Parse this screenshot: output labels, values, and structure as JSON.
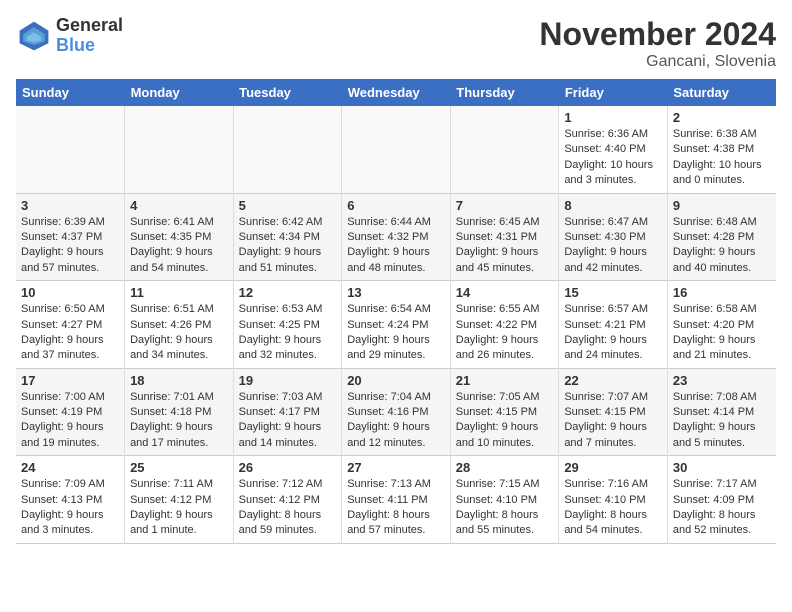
{
  "header": {
    "logo_line1": "General",
    "logo_line2": "Blue",
    "month": "November 2024",
    "location": "Gancani, Slovenia"
  },
  "days_of_week": [
    "Sunday",
    "Monday",
    "Tuesday",
    "Wednesday",
    "Thursday",
    "Friday",
    "Saturday"
  ],
  "weeks": [
    [
      {
        "day": "",
        "info": ""
      },
      {
        "day": "",
        "info": ""
      },
      {
        "day": "",
        "info": ""
      },
      {
        "day": "",
        "info": ""
      },
      {
        "day": "",
        "info": ""
      },
      {
        "day": "1",
        "info": "Sunrise: 6:36 AM\nSunset: 4:40 PM\nDaylight: 10 hours and 3 minutes."
      },
      {
        "day": "2",
        "info": "Sunrise: 6:38 AM\nSunset: 4:38 PM\nDaylight: 10 hours and 0 minutes."
      }
    ],
    [
      {
        "day": "3",
        "info": "Sunrise: 6:39 AM\nSunset: 4:37 PM\nDaylight: 9 hours and 57 minutes."
      },
      {
        "day": "4",
        "info": "Sunrise: 6:41 AM\nSunset: 4:35 PM\nDaylight: 9 hours and 54 minutes."
      },
      {
        "day": "5",
        "info": "Sunrise: 6:42 AM\nSunset: 4:34 PM\nDaylight: 9 hours and 51 minutes."
      },
      {
        "day": "6",
        "info": "Sunrise: 6:44 AM\nSunset: 4:32 PM\nDaylight: 9 hours and 48 minutes."
      },
      {
        "day": "7",
        "info": "Sunrise: 6:45 AM\nSunset: 4:31 PM\nDaylight: 9 hours and 45 minutes."
      },
      {
        "day": "8",
        "info": "Sunrise: 6:47 AM\nSunset: 4:30 PM\nDaylight: 9 hours and 42 minutes."
      },
      {
        "day": "9",
        "info": "Sunrise: 6:48 AM\nSunset: 4:28 PM\nDaylight: 9 hours and 40 minutes."
      }
    ],
    [
      {
        "day": "10",
        "info": "Sunrise: 6:50 AM\nSunset: 4:27 PM\nDaylight: 9 hours and 37 minutes."
      },
      {
        "day": "11",
        "info": "Sunrise: 6:51 AM\nSunset: 4:26 PM\nDaylight: 9 hours and 34 minutes."
      },
      {
        "day": "12",
        "info": "Sunrise: 6:53 AM\nSunset: 4:25 PM\nDaylight: 9 hours and 32 minutes."
      },
      {
        "day": "13",
        "info": "Sunrise: 6:54 AM\nSunset: 4:24 PM\nDaylight: 9 hours and 29 minutes."
      },
      {
        "day": "14",
        "info": "Sunrise: 6:55 AM\nSunset: 4:22 PM\nDaylight: 9 hours and 26 minutes."
      },
      {
        "day": "15",
        "info": "Sunrise: 6:57 AM\nSunset: 4:21 PM\nDaylight: 9 hours and 24 minutes."
      },
      {
        "day": "16",
        "info": "Sunrise: 6:58 AM\nSunset: 4:20 PM\nDaylight: 9 hours and 21 minutes."
      }
    ],
    [
      {
        "day": "17",
        "info": "Sunrise: 7:00 AM\nSunset: 4:19 PM\nDaylight: 9 hours and 19 minutes."
      },
      {
        "day": "18",
        "info": "Sunrise: 7:01 AM\nSunset: 4:18 PM\nDaylight: 9 hours and 17 minutes."
      },
      {
        "day": "19",
        "info": "Sunrise: 7:03 AM\nSunset: 4:17 PM\nDaylight: 9 hours and 14 minutes."
      },
      {
        "day": "20",
        "info": "Sunrise: 7:04 AM\nSunset: 4:16 PM\nDaylight: 9 hours and 12 minutes."
      },
      {
        "day": "21",
        "info": "Sunrise: 7:05 AM\nSunset: 4:15 PM\nDaylight: 9 hours and 10 minutes."
      },
      {
        "day": "22",
        "info": "Sunrise: 7:07 AM\nSunset: 4:15 PM\nDaylight: 9 hours and 7 minutes."
      },
      {
        "day": "23",
        "info": "Sunrise: 7:08 AM\nSunset: 4:14 PM\nDaylight: 9 hours and 5 minutes."
      }
    ],
    [
      {
        "day": "24",
        "info": "Sunrise: 7:09 AM\nSunset: 4:13 PM\nDaylight: 9 hours and 3 minutes."
      },
      {
        "day": "25",
        "info": "Sunrise: 7:11 AM\nSunset: 4:12 PM\nDaylight: 9 hours and 1 minute."
      },
      {
        "day": "26",
        "info": "Sunrise: 7:12 AM\nSunset: 4:12 PM\nDaylight: 8 hours and 59 minutes."
      },
      {
        "day": "27",
        "info": "Sunrise: 7:13 AM\nSunset: 4:11 PM\nDaylight: 8 hours and 57 minutes."
      },
      {
        "day": "28",
        "info": "Sunrise: 7:15 AM\nSunset: 4:10 PM\nDaylight: 8 hours and 55 minutes."
      },
      {
        "day": "29",
        "info": "Sunrise: 7:16 AM\nSunset: 4:10 PM\nDaylight: 8 hours and 54 minutes."
      },
      {
        "day": "30",
        "info": "Sunrise: 7:17 AM\nSunset: 4:09 PM\nDaylight: 8 hours and 52 minutes."
      }
    ]
  ]
}
